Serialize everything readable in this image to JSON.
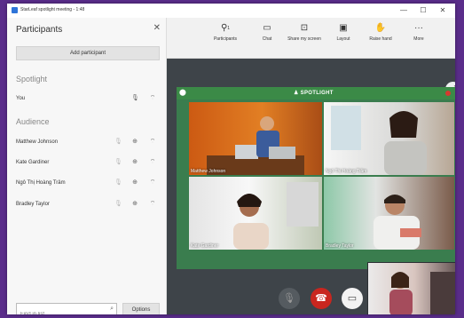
{
  "window": {
    "title": "StarLeaf spotlight meeting - 1:48",
    "controls": {
      "minimize": "—",
      "maximize": "☐",
      "close": "✕"
    }
  },
  "sidebar": {
    "header": "Participants",
    "close_icon": "✕",
    "add_button": "Add participant",
    "spotlight_heading": "Spotlight",
    "spotlight_participants": [
      {
        "name": "You",
        "icons": [
          "mic-icon",
          "wifi-icon"
        ]
      }
    ],
    "audience_heading": "Audience",
    "audience_participants": [
      {
        "name": "Matthew Johnson",
        "mic_muted": true
      },
      {
        "name": "Kate Gardiner",
        "mic_muted": true
      },
      {
        "name": "Ngô Thị Hoàng Trâm",
        "mic_muted": true
      },
      {
        "name": "Bradley Taylor",
        "mic_muted": true
      }
    ],
    "search_placeholder": "Find in list",
    "options_button": "Options"
  },
  "toolbar": {
    "items": [
      {
        "label": "Participants",
        "icon": "participants-icon",
        "glyph": "⚲",
        "badge": "1"
      },
      {
        "label": "Chat",
        "icon": "chat-icon",
        "glyph": "▭"
      },
      {
        "label": "Share my screen",
        "icon": "share-screen-icon",
        "glyph": "⊡"
      },
      {
        "label": "Layout",
        "icon": "layout-icon",
        "glyph": "▣"
      },
      {
        "label": "Raise hand",
        "icon": "hand-icon",
        "glyph": "✋"
      },
      {
        "label": "More",
        "icon": "more-icon",
        "glyph": "···"
      }
    ]
  },
  "stage": {
    "banner": "SPOTLIGHT",
    "tiles": [
      {
        "name": "Matthew Johnson"
      },
      {
        "name": "Ngô Thị Hoàng Trâm"
      },
      {
        "name": "Kate Gardiner"
      },
      {
        "name": "Bradley Taylor"
      }
    ]
  },
  "controls": {
    "mic": "mic-off-icon",
    "hangup": "hangup-icon",
    "camera": "camera-icon"
  },
  "colors": {
    "spotlight_green": "#3b8a47",
    "hangup_red": "#c9261f",
    "desktop_purple": "#5a2d8a"
  }
}
